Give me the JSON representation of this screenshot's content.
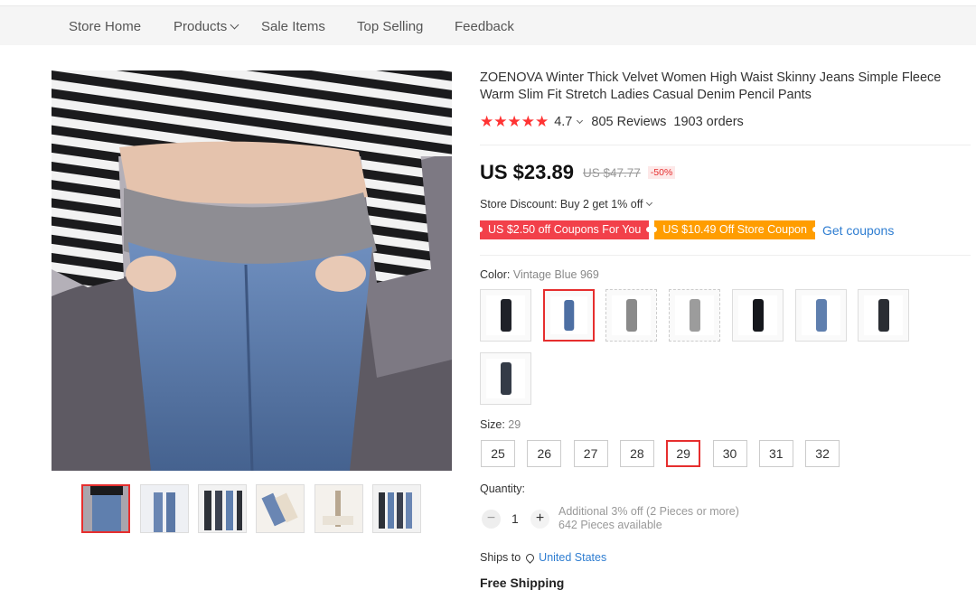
{
  "nav": {
    "items": [
      "Store Home",
      "Products",
      "Sale Items",
      "Top Selling",
      "Feedback"
    ]
  },
  "product": {
    "title": "ZOENOVA Winter Thick Velvet Women High Waist Skinny Jeans Simple Fleece Warm Slim Fit Stretch Ladies Casual Denim Pencil Pants",
    "stars": "★★★★★",
    "rating": "4.7",
    "reviews": "805 Reviews",
    "orders": "1903 orders",
    "price": "US $23.89",
    "old_price": "US $47.77",
    "discount_pct": "-50%",
    "store_discount": "Store Discount: Buy 2 get 1% off",
    "coupon_1": "US $2.50 off Coupons For You",
    "coupon_2": "US $10.49 Off Store Coupon",
    "get_coupons": "Get coupons",
    "color_label": "Color:",
    "color_value": "Vintage Blue 969",
    "size_label": "Size:",
    "size_value": "29",
    "sizes": [
      "25",
      "26",
      "27",
      "28",
      "29",
      "30",
      "31",
      "32"
    ],
    "selected_size": "29",
    "quantity_label": "Quantity:",
    "quantity_value": "1",
    "qty_minus": "−",
    "qty_plus": "+",
    "qty_note_1": "Additional 3% off (2 Pieces or more)",
    "qty_note_2": "642 Pieces available",
    "ships_label": "Ships to",
    "ships_country": "United States",
    "shipping": "Free Shipping"
  },
  "colors": {
    "swatches": [
      "#1f2128",
      "#4d6fa3",
      "#8a8a8a",
      "#9c9c9c",
      "#15171c",
      "#5f7fae",
      "#2a2d33",
      "#343b47"
    ],
    "selected_index": 1
  },
  "gallery": {
    "thumb_colors": [
      "#5f7fae",
      "#6a86b3",
      "#2d3138",
      "#c9ccd8",
      "#b8a790",
      "#3b4150"
    ]
  }
}
